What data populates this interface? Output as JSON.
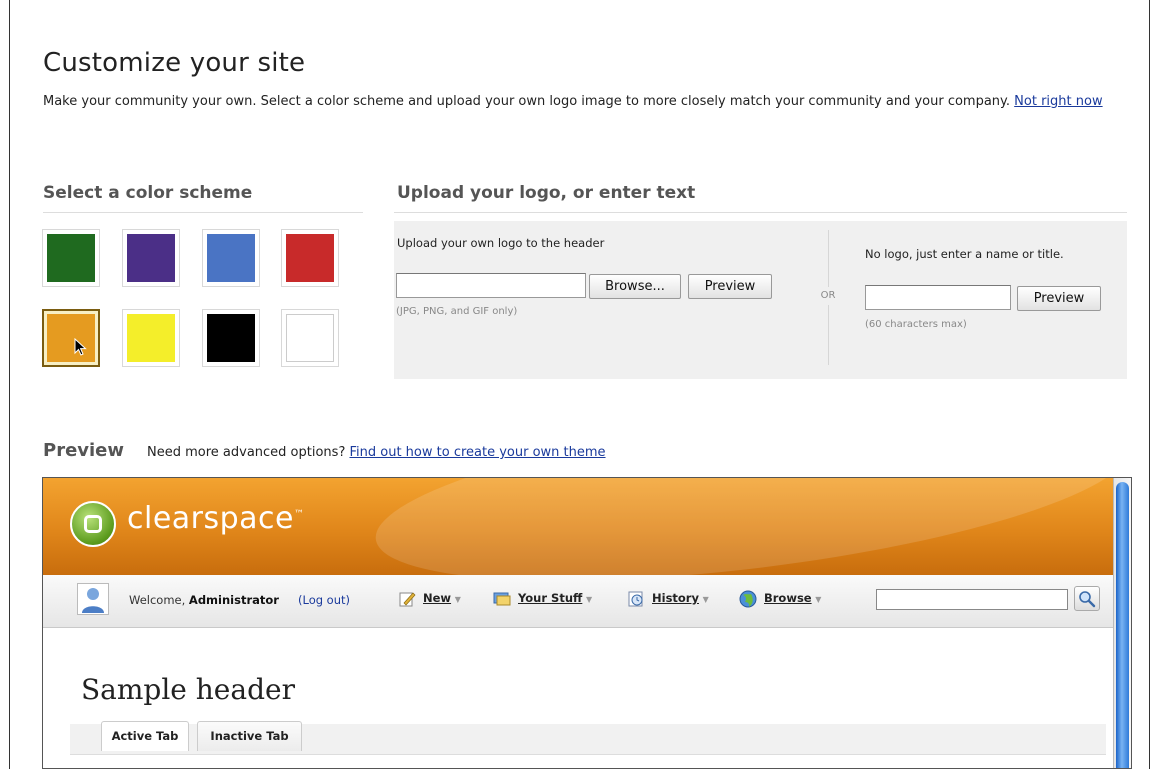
{
  "page": {
    "title": "Customize your site",
    "intro": "Make your community your own. Select a color scheme and upload your own logo image to more closely match your community and your company.",
    "not_now_link": "Not right now"
  },
  "color_scheme": {
    "heading": "Select a color scheme",
    "swatches": [
      {
        "name": "green",
        "color": "#1f6a1f",
        "selected": false
      },
      {
        "name": "purple",
        "color": "#4b2f87",
        "selected": false
      },
      {
        "name": "blue",
        "color": "#4a74c4",
        "selected": false
      },
      {
        "name": "red",
        "color": "#c82a2a",
        "selected": false
      },
      {
        "name": "orange",
        "color": "#e59b20",
        "selected": true
      },
      {
        "name": "yellow",
        "color": "#f4ee2a",
        "selected": false
      },
      {
        "name": "black",
        "color": "#000000",
        "selected": false
      },
      {
        "name": "white",
        "color": "#ffffff",
        "selected": false
      }
    ]
  },
  "upload": {
    "heading": "Upload your logo, or enter text",
    "logo_label": "Upload your own logo to the header",
    "browse_label": "Browse...",
    "preview_label": "Preview",
    "file_hint": "(JPG, PNG, and GIF only)",
    "file_value": "",
    "or_label": "OR",
    "text_label": "No logo, just enter a name or title.",
    "text_value": "",
    "text_preview_label": "Preview",
    "text_hint": "(60 characters max)"
  },
  "preview": {
    "heading": "Preview",
    "advanced_text": "Need more advanced options?",
    "advanced_link": "Find out how to create your own theme",
    "site": {
      "logo_text": "clearspace",
      "logo_mark": "™",
      "welcome_text": "Welcome,",
      "user_name": "Administrator",
      "logout_label": "(Log out)",
      "nav": [
        {
          "label": "New",
          "icon": "new-document-icon"
        },
        {
          "label": "Your Stuff",
          "icon": "your-stuff-icon"
        },
        {
          "label": "History",
          "icon": "history-icon"
        },
        {
          "label": "Browse",
          "icon": "globe-icon"
        }
      ],
      "search_value": "",
      "sample_header": "Sample header",
      "active_tab": "Active Tab",
      "inactive_tab": "Inactive Tab",
      "banner_color": "#e0861a"
    }
  }
}
